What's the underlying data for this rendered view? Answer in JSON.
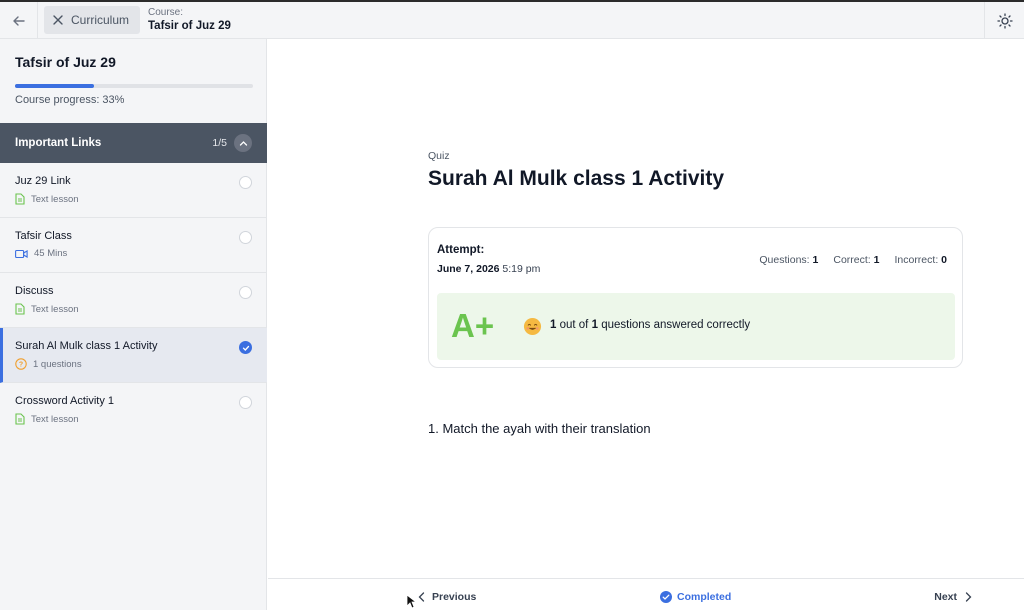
{
  "header": {
    "curriculum_label": "Curriculum",
    "course_caption": "Course:",
    "course_name": "Tafsir of Juz 29"
  },
  "sidebar": {
    "title": "Tafsir of Juz 29",
    "progress_percent": 33,
    "progress_label": "Course progress: 33%",
    "section": {
      "title": "Important Links",
      "count": "1/5"
    },
    "lessons": [
      {
        "title": "Juz 29 Link",
        "meta": "Text lesson",
        "icon": "text-lesson-icon",
        "completed": false
      },
      {
        "title": "Tafsir Class",
        "meta": "45 Mins",
        "icon": "video-icon",
        "completed": false
      },
      {
        "title": "Discuss",
        "meta": "Text lesson",
        "icon": "text-lesson-icon",
        "completed": false
      },
      {
        "title": "Surah Al Mulk class 1 Activity",
        "meta": "1 questions",
        "icon": "quiz-icon",
        "completed": true
      },
      {
        "title": "Crossword Activity 1",
        "meta": "Text lesson",
        "icon": "text-lesson-icon",
        "completed": false
      }
    ]
  },
  "main": {
    "label": "Quiz",
    "title": "Surah Al Mulk class 1 Activity",
    "attempt": {
      "label": "Attempt:",
      "date": "June 7, 2026",
      "time": "5:19 pm",
      "questions_label": "Questions:",
      "questions_value": "1",
      "correct_label": "Correct:",
      "correct_value": "1",
      "incorrect_label": "Incorrect:",
      "incorrect_value": "0",
      "grade": "A+",
      "result_count": "1",
      "result_mid": "out of",
      "result_total": "1",
      "result_tail": "questions answered correctly"
    },
    "question": "1. Match the ayah with their translation"
  },
  "footer": {
    "previous_label": "Previous",
    "completed_label": "Completed",
    "next_label": "Next"
  },
  "colors": {
    "accent": "#3b6fe0",
    "grade": "#6bc44f",
    "result_bg": "#edf7ea",
    "section_bg": "#4b5563"
  }
}
